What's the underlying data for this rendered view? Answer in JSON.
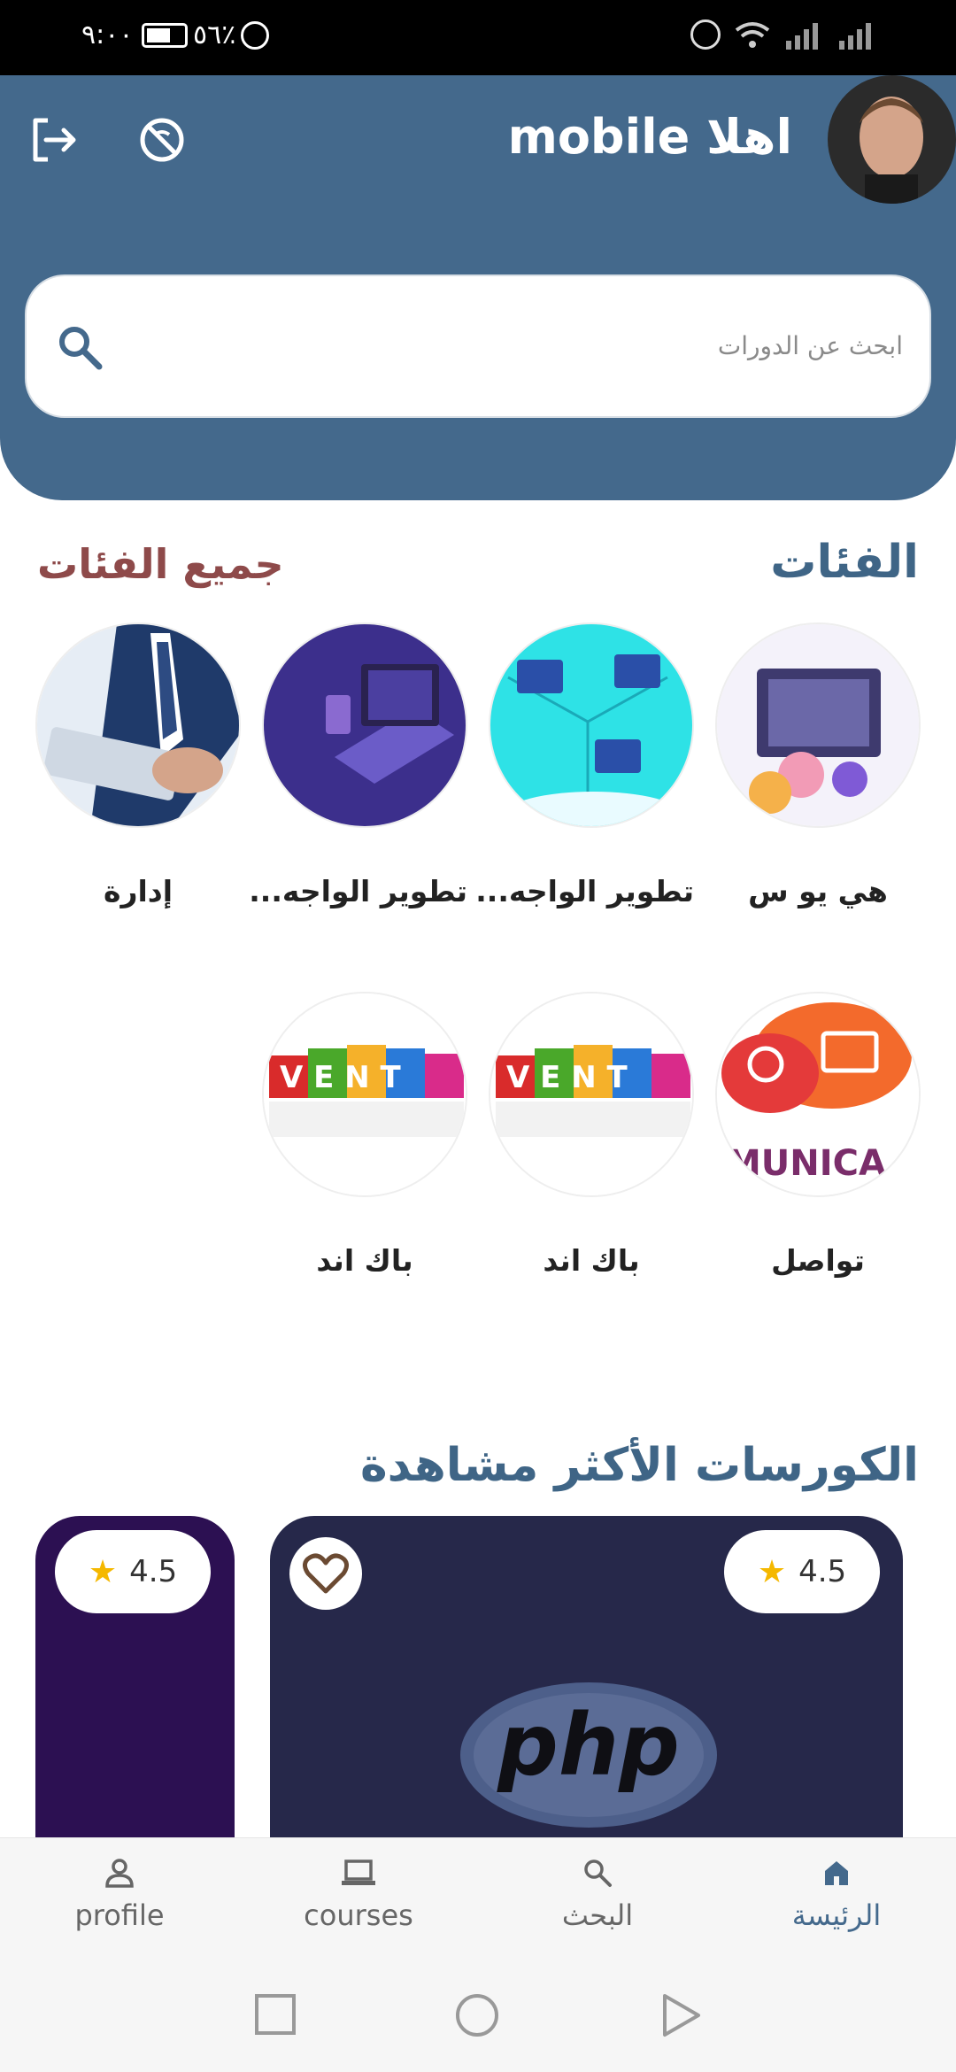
{
  "status_bar": {
    "time": "٩:٠٠",
    "battery": "٥٦٪"
  },
  "header": {
    "greeting": "اهلا mobile",
    "search_placeholder": "ابحث عن الدورات"
  },
  "categories": {
    "title": "الفئات",
    "all_link": "جميع الفئات",
    "items": [
      {
        "label": "هي يو س"
      },
      {
        "label": "تطوير الواجه..."
      },
      {
        "label": "تطوير الواجه..."
      },
      {
        "label": "إدارة"
      },
      {
        "label": "تواصل"
      },
      {
        "label": "باك اند"
      },
      {
        "label": "باك اند"
      }
    ]
  },
  "popular": {
    "title": "الكورسات الأكثر مشاهدة",
    "courses": [
      {
        "rating": "4.5",
        "logo_text": "php"
      },
      {
        "rating": "4.5"
      }
    ]
  },
  "bottom_nav": {
    "items": [
      {
        "label": "profile"
      },
      {
        "label": "courses"
      },
      {
        "label": "البحث"
      },
      {
        "label": "الرئيسة"
      }
    ]
  },
  "colors": {
    "primary": "#44698c",
    "accent_red": "#8e4a4a",
    "star": "#f5b800"
  }
}
